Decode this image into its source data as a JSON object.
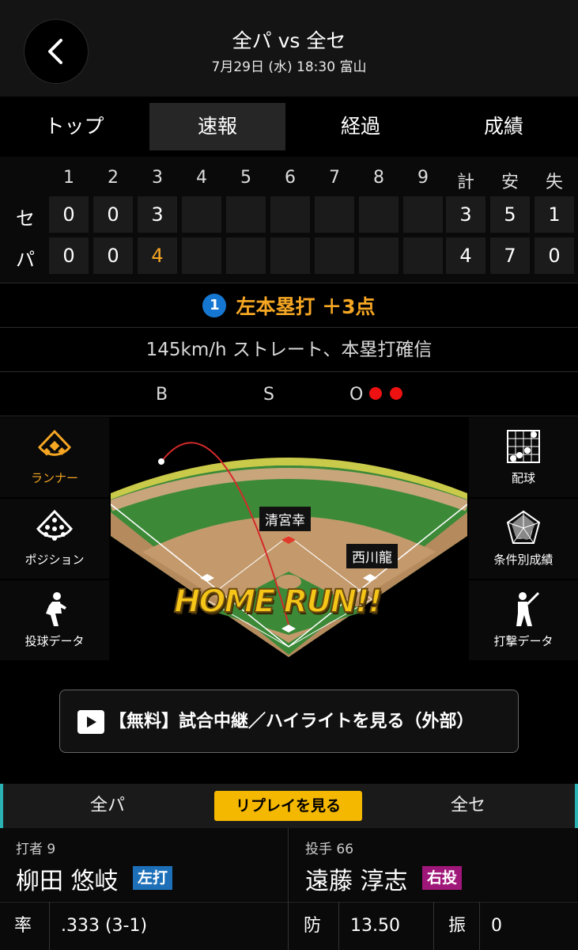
{
  "header": {
    "title": "全パ vs 全セ",
    "subtitle": "7月29日 (水) 18:30 富山"
  },
  "tabs": [
    {
      "label": "トップ",
      "active": false
    },
    {
      "label": "速報",
      "active": true
    },
    {
      "label": "経過",
      "active": false
    },
    {
      "label": "成績",
      "active": false
    }
  ],
  "scoreboard": {
    "columns": [
      "1",
      "2",
      "3",
      "4",
      "5",
      "6",
      "7",
      "8",
      "9",
      "計",
      "安",
      "失"
    ],
    "rows": [
      {
        "team": "セ",
        "cells": [
          "0",
          "0",
          "3",
          "",
          "",
          "",
          "",
          "",
          "",
          "3",
          "5",
          "1"
        ]
      },
      {
        "team": "パ",
        "cells": [
          "0",
          "0",
          "4",
          "",
          "",
          "",
          "",
          "",
          "",
          "4",
          "7",
          "0"
        ]
      }
    ]
  },
  "play": {
    "badge": "1",
    "text": "左本塁打 ＋3点",
    "accent": "#f5a623"
  },
  "pitch_info": "145km/h ストレート、本塁打確信",
  "count": {
    "b_label": "B",
    "s_label": "S",
    "o_label": "O",
    "outs": 2
  },
  "side_menu_left": [
    {
      "label": "ランナー",
      "icon": "runner-diamond-icon",
      "active": true
    },
    {
      "label": "ポジション",
      "icon": "position-field-icon",
      "active": false
    },
    {
      "label": "投球データ",
      "icon": "pitcher-icon",
      "active": false
    }
  ],
  "side_menu_right": [
    {
      "label": "配球",
      "icon": "pitch-grid-icon"
    },
    {
      "label": "条件別成績",
      "icon": "radar-chart-icon"
    },
    {
      "label": "打撃データ",
      "icon": "batter-icon"
    }
  ],
  "field": {
    "fielders": [
      "清宮幸",
      "西川龍"
    ],
    "banner": "HOME RUN!!"
  },
  "video_button": {
    "label": "【無料】試合中継／ハイライトを見る（外部）"
  },
  "team_bar": {
    "left": "全パ",
    "right": "全セ",
    "replay": "リプレイを見る"
  },
  "batter": {
    "pos": "打者 9",
    "name": "柳田 悠岐",
    "hand": "左打",
    "hand_color": "#1d6fb8"
  },
  "pitcher": {
    "pos": "投手 66",
    "name": "遠藤 淳志",
    "hand": "右投",
    "hand_color": "#a0177a"
  },
  "batter_stats": {
    "label": "率",
    "value": ".333 (3-1)"
  },
  "pitcher_stats": [
    {
      "label": "防",
      "value": "13.50"
    },
    {
      "label": "振",
      "value": "0"
    }
  ]
}
